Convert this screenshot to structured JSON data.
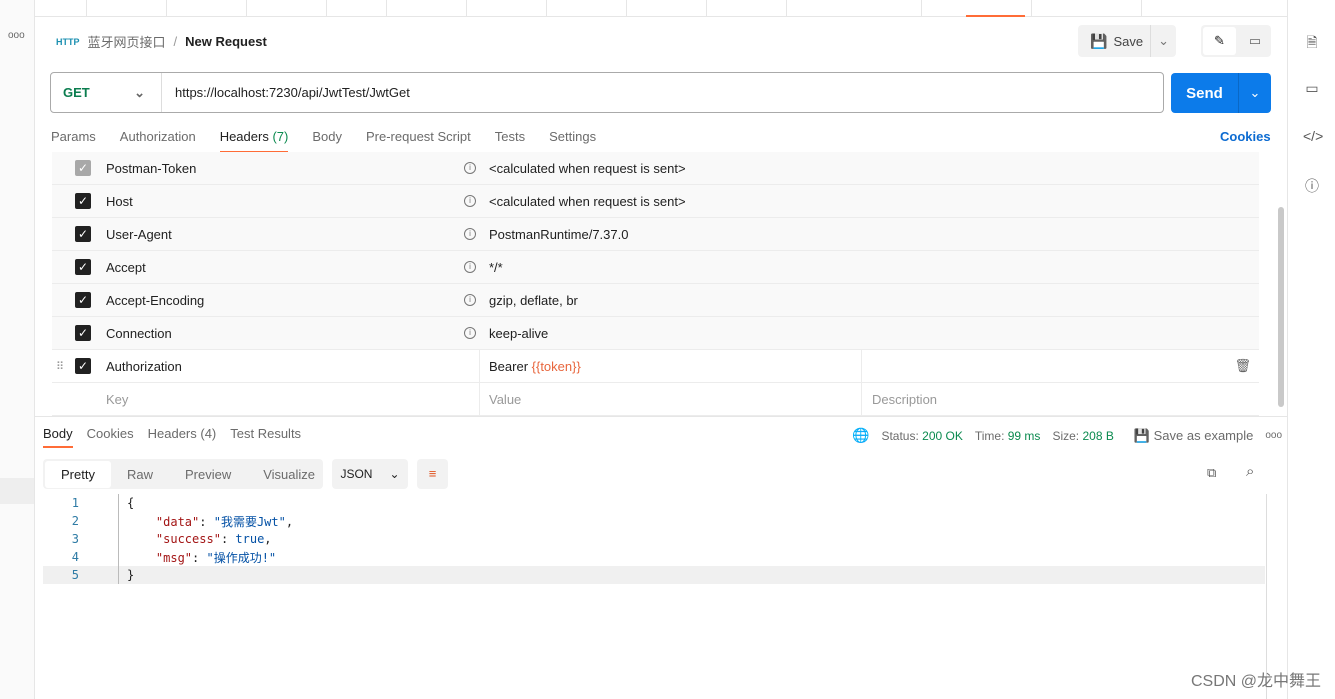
{
  "breadcrumb": {
    "collection": "蓝牙网页接口",
    "separator": "/",
    "request": "New Request"
  },
  "toolbar": {
    "save_label": "Save"
  },
  "request": {
    "method": "GET",
    "url": "https://localhost:7230/api/JwtTest/JwtGet",
    "send_label": "Send"
  },
  "tabs": {
    "params": "Params",
    "authorization": "Authorization",
    "headers": "Headers",
    "headers_count": "(7)",
    "body": "Body",
    "prerequest": "Pre-request Script",
    "tests": "Tests",
    "settings": "Settings",
    "cookies": "Cookies"
  },
  "headers": [
    {
      "key": "Postman-Token",
      "value": "<calculated when request is sent>",
      "checked": true,
      "disabled": true
    },
    {
      "key": "Host",
      "value": "<calculated when request is sent>",
      "checked": true
    },
    {
      "key": "User-Agent",
      "value": "PostmanRuntime/7.37.0",
      "checked": true
    },
    {
      "key": "Accept",
      "value": "*/*",
      "checked": true
    },
    {
      "key": "Accept-Encoding",
      "value": "gzip, deflate, br",
      "checked": true
    },
    {
      "key": "Connection",
      "value": "keep-alive",
      "checked": true
    }
  ],
  "auth_row": {
    "key": "Authorization",
    "value_prefix": "Bearer ",
    "value_var": "{{token}}"
  },
  "new_row": {
    "key_placeholder": "Key",
    "value_placeholder": "Value",
    "description_placeholder": "Description"
  },
  "response": {
    "tabs": {
      "body": "Body",
      "cookies": "Cookies",
      "headers": "Headers (4)",
      "tests": "Test Results"
    },
    "status_label": "Status:",
    "status": "200 OK",
    "time_label": "Time:",
    "time": "99 ms",
    "size_label": "Size:",
    "size": "208 B",
    "save_example": "Save as example",
    "views": {
      "pretty": "Pretty",
      "raw": "Raw",
      "preview": "Preview",
      "visualize": "Visualize"
    },
    "format": "JSON",
    "lines": [
      {
        "n": "1",
        "text": "{"
      },
      {
        "n": "2",
        "key": "\"data\"",
        "value": "\"我需要Jwt\"",
        "end": ","
      },
      {
        "n": "3",
        "key": "\"success\"",
        "value": "true",
        "end": ","
      },
      {
        "n": "4",
        "key": "\"msg\"",
        "value": "\"操作成功!\"",
        "end": ""
      },
      {
        "n": "5",
        "text": "}"
      }
    ]
  },
  "watermark": "CSDN @龙中舞王",
  "colors": {
    "accent": "#ff6c37",
    "send": "#0c7bea",
    "status_ok": "#0b8a4f"
  }
}
